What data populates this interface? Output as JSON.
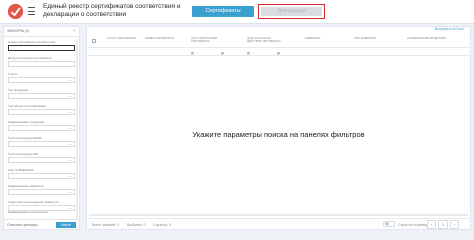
{
  "header": {
    "title": "Единый реестр сертификатов соответствия и декларации о соответствии",
    "tab_certificates": "Сертификаты",
    "tab_declarations": "Декларации"
  },
  "sidebar": {
    "heading": "ФИЛЬТРЫ (1)",
    "collapse_icon": "chevron-left-icon",
    "filters": [
      {
        "label": "Номер сертификата соответствия",
        "value": "",
        "caret": false
      },
      {
        "label": "Дата регистрации сертификата",
        "value": "",
        "caret": false
      },
      {
        "label": "Статус",
        "value": "",
        "caret": true
      },
      {
        "label": "Тип продукции",
        "value": "",
        "caret": true
      },
      {
        "label": "Тип объекта сертификации",
        "value": "",
        "caret": true
      },
      {
        "label": "Наименование продукции",
        "value": "",
        "caret": true
      },
      {
        "label": "Группа продукции ЕАЭС",
        "value": "",
        "caret": true
      },
      {
        "label": "Группа продукции РФ",
        "value": "",
        "caret": true
      },
      {
        "label": "Код ТН ВЭД ЕАЭС",
        "value": "",
        "caret": true
      },
      {
        "label": "Наименование заявителя",
        "value": "",
        "caret": true
      },
      {
        "label": "Адрес места нахождения заявителя",
        "value": "",
        "caret": true
      },
      {
        "label": "Наименование изготовителя",
        "value": "",
        "caret": true
      }
    ],
    "clear_label": "Очистить фильтры",
    "find_label": "Найти"
  },
  "main": {
    "export_label": "Выгрузить в Excel",
    "columns": [
      "СТАТУС СЕРТИФИКАТА",
      "НОМЕР СЕРТИФИКАТА",
      "ДАТА РЕГИСТРАЦИИ СЕРТИФИКАТА",
      "ДАТА ОКОНЧАНИЯ ДЕЙСТВИЯ СЕРТИФИКАТА",
      "ЗАЯВИТЕЛЬ",
      "ИНН ЗАЯВИТЕЛЯ",
      "НАИМЕНОВАНИЕ ПРОДУКЦИИ"
    ],
    "empty_message": "Укажите параметры поиска на панелях фильтров",
    "footer": {
      "shown": "Всего записей: 0",
      "selected": "Выбрано: 0",
      "pages": "Страниц: 0",
      "page_size": "50",
      "page_size_label": "Строк на странице",
      "prev": "‹",
      "page": "1",
      "next": "›"
    }
  },
  "colors": {
    "accent": "#3aa0cf",
    "highlight": "#d42b2b",
    "logo": "#e2574c"
  }
}
